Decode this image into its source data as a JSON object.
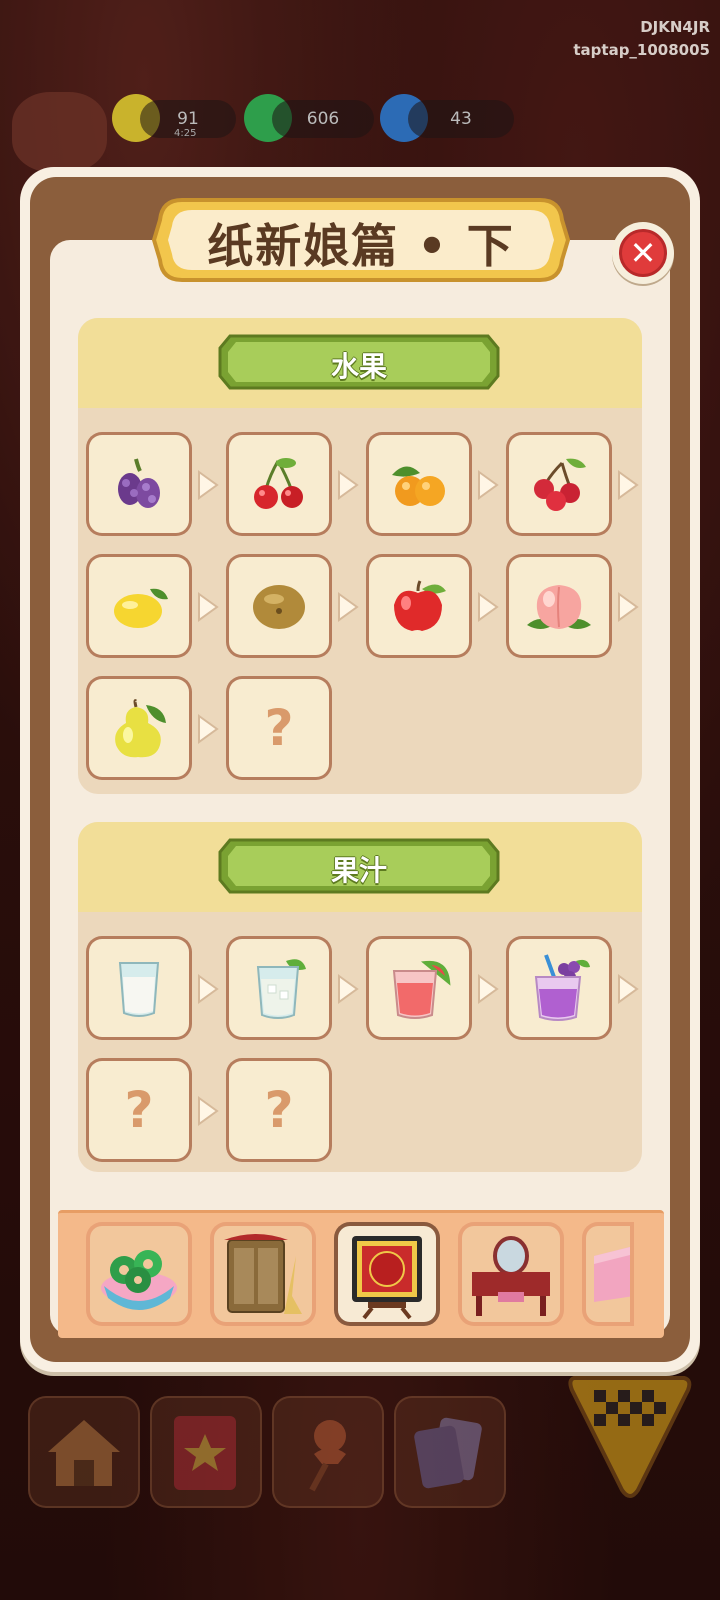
{
  "watermark": {
    "line1": "DJKN4JR",
    "line2": "taptap_1008005"
  },
  "resources": [
    {
      "name": "energy",
      "value": "91",
      "sub": "4:25"
    },
    {
      "name": "coin",
      "value": "606"
    },
    {
      "name": "gem",
      "value": "43"
    }
  ],
  "modal": {
    "title": "纸新娘篇 • 下",
    "close_icon": "close-icon"
  },
  "sections": [
    {
      "title": "水果",
      "items": [
        {
          "icon": "mulberry-icon",
          "label": ""
        },
        {
          "icon": "cherry-icon",
          "label": ""
        },
        {
          "icon": "kumquat-icon",
          "label": ""
        },
        {
          "icon": "hawthorn-icon",
          "label": ""
        },
        {
          "icon": "lemon-icon",
          "label": ""
        },
        {
          "icon": "kiwi-icon",
          "label": ""
        },
        {
          "icon": "apple-icon",
          "label": ""
        },
        {
          "icon": "peach-icon",
          "label": ""
        },
        {
          "icon": "pear-icon",
          "label": ""
        },
        {
          "icon": "unknown-icon",
          "label": "?"
        }
      ]
    },
    {
      "title": "果汁",
      "items": [
        {
          "icon": "milk-glass-icon",
          "label": ""
        },
        {
          "icon": "mint-drink-icon",
          "label": ""
        },
        {
          "icon": "watermelon-juice-icon",
          "label": ""
        },
        {
          "icon": "grape-juice-icon",
          "label": ""
        },
        {
          "icon": "unknown-icon",
          "label": "?"
        },
        {
          "icon": "unknown-icon",
          "label": "?"
        }
      ]
    }
  ],
  "category_tabs": [
    {
      "icon": "jade-coins-bowl-icon",
      "selected": false
    },
    {
      "icon": "cabinet-broom-icon",
      "selected": false
    },
    {
      "icon": "red-scroll-screen-icon",
      "selected": true
    },
    {
      "icon": "vanity-dresser-icon",
      "selected": false
    },
    {
      "icon": "pink-box-icon",
      "selected": false
    }
  ],
  "dock": [
    {
      "icon": "home-icon"
    },
    {
      "icon": "book-icon"
    },
    {
      "icon": "pin-icon"
    },
    {
      "icon": "cards-icon"
    },
    {
      "icon": "play-icon"
    }
  ],
  "colors": {
    "frame_brown": "#8b5e3c",
    "section_head_yellow": "#f2de98",
    "label_green": "#9bc448",
    "close_red": "#e03b3b",
    "tab_orange": "#f4b98a"
  }
}
